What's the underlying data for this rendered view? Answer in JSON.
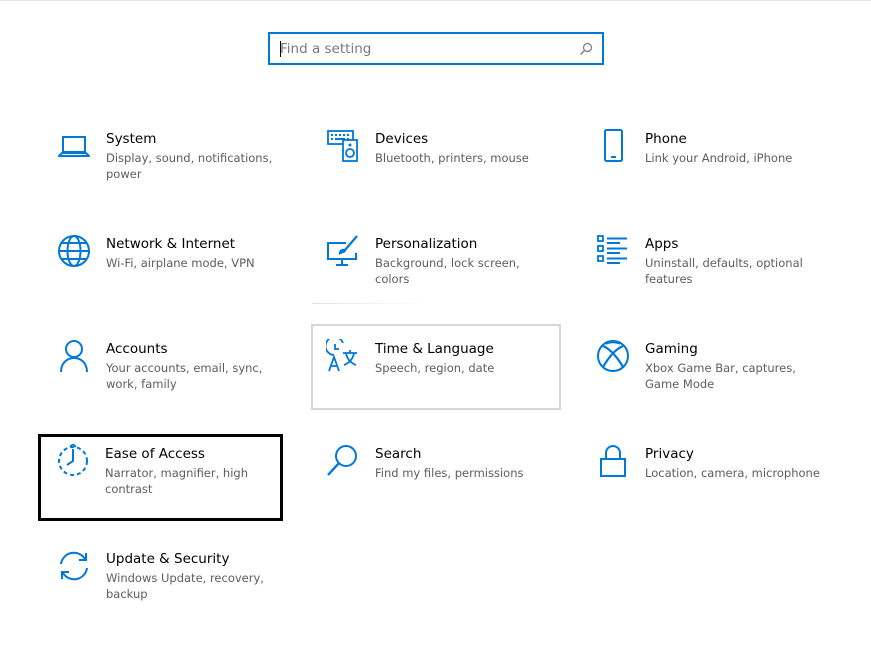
{
  "search": {
    "placeholder": "Find a setting",
    "value": ""
  },
  "accent_color": "#0078d7",
  "tiles": [
    {
      "id": "system",
      "title": "System",
      "description": "Display, sound, notifications, power",
      "icon": "laptop-icon"
    },
    {
      "id": "devices",
      "title": "Devices",
      "description": "Bluetooth, printers, mouse",
      "icon": "devices-icon"
    },
    {
      "id": "phone",
      "title": "Phone",
      "description": "Link your Android, iPhone",
      "icon": "phone-icon"
    },
    {
      "id": "network",
      "title": "Network & Internet",
      "description": "Wi-Fi, airplane mode, VPN",
      "icon": "globe-icon"
    },
    {
      "id": "personalization",
      "title": "Personalization",
      "description": "Background, lock screen, colors",
      "icon": "paint-monitor-icon"
    },
    {
      "id": "apps",
      "title": "Apps",
      "description": "Uninstall, defaults, optional features",
      "icon": "apps-list-icon"
    },
    {
      "id": "accounts",
      "title": "Accounts",
      "description": "Your accounts, email, sync, work, family",
      "icon": "person-icon"
    },
    {
      "id": "time-language",
      "title": "Time & Language",
      "description": "Speech, region, date",
      "icon": "time-language-icon"
    },
    {
      "id": "gaming",
      "title": "Gaming",
      "description": "Xbox Game Bar, captures, Game Mode",
      "icon": "xbox-icon"
    },
    {
      "id": "ease-of-access",
      "title": "Ease of Access",
      "description": "Narrator, magnifier, high contrast",
      "icon": "ease-of-access-icon"
    },
    {
      "id": "search",
      "title": "Search",
      "description": "Find my files, permissions",
      "icon": "magnifier-icon"
    },
    {
      "id": "privacy",
      "title": "Privacy",
      "description": "Location, camera, microphone",
      "icon": "lock-icon"
    },
    {
      "id": "update-security",
      "title": "Update & Security",
      "description": "Windows Update, recovery, backup",
      "icon": "sync-arrows-icon"
    }
  ]
}
